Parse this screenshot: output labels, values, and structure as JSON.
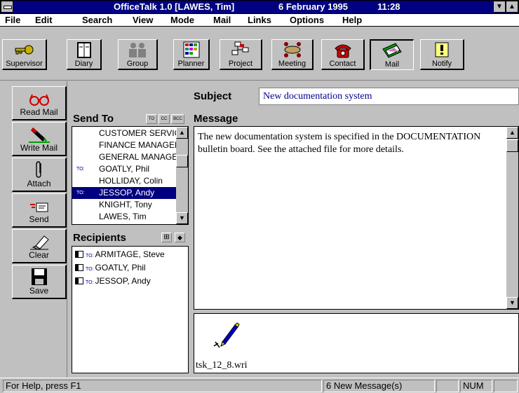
{
  "window": {
    "app_title": "OfficeTalk 1.0 [LAWES, Tim]",
    "date": "6 February 1995",
    "time": "11:28"
  },
  "menu": [
    "File",
    "Edit",
    "Search",
    "View",
    "Mode",
    "Mail",
    "Links",
    "Options",
    "Help"
  ],
  "toolbar": [
    {
      "label": "Supervisor",
      "icon": "key-icon"
    },
    {
      "label": "Diary",
      "icon": "diary-icon"
    },
    {
      "label": "Group",
      "icon": "group-icon"
    },
    {
      "label": "Planner",
      "icon": "planner-icon"
    },
    {
      "label": "Project",
      "icon": "project-icon"
    },
    {
      "label": "Meeting",
      "icon": "meeting-icon"
    },
    {
      "label": "Contact",
      "icon": "telephone-icon"
    },
    {
      "label": "Mail",
      "icon": "mail-icon",
      "pressed": true
    },
    {
      "label": "Notify",
      "icon": "notify-icon"
    }
  ],
  "sidebar": [
    {
      "label": "Read Mail",
      "icon": "glasses-icon"
    },
    {
      "label": "Write Mail",
      "icon": "pen-icon"
    },
    {
      "label": "Attach",
      "icon": "paperclip-icon"
    },
    {
      "label": "Send",
      "icon": "send-icon"
    },
    {
      "label": "Clear",
      "icon": "eraser-icon"
    },
    {
      "label": "Save",
      "icon": "floppy-icon"
    }
  ],
  "compose": {
    "subject_label": "Subject",
    "subject_value": "New documentation system",
    "send_to_label": "Send To",
    "to_btn": "TO",
    "cc_btn": "CC",
    "bcc_btn": "BCC",
    "message_label": "Message",
    "message_body": "The new documentation system is specified in the DOCUMENTATION bulletin board. See the attached file for more details.",
    "recipients_label": "Recipients",
    "attachment_name": "tsk_12_8.wri"
  },
  "send_to_list": [
    {
      "to": "",
      "name": "CUSTOMER SERVICES"
    },
    {
      "to": "",
      "name": "FINANCE MANAGER"
    },
    {
      "to": "",
      "name": "GENERAL MANAGER"
    },
    {
      "to": "TO:",
      "name": "GOATLY, Phil"
    },
    {
      "to": "",
      "name": "HOLLIDAY, Colin"
    },
    {
      "to": "TO:",
      "name": "JESSOP, Andy",
      "selected": true
    },
    {
      "to": "",
      "name": "KNIGHT, Tony"
    },
    {
      "to": "",
      "name": "LAWES, Tim"
    }
  ],
  "recipients": [
    {
      "to": "TO:",
      "name": "ARMITAGE, Steve"
    },
    {
      "to": "TO:",
      "name": "GOATLY, Phil"
    },
    {
      "to": "TO:",
      "name": "JESSOP, Andy"
    }
  ],
  "status": {
    "help": "For Help, press F1",
    "messages": "6 New Message(s)",
    "num": "NUM"
  }
}
